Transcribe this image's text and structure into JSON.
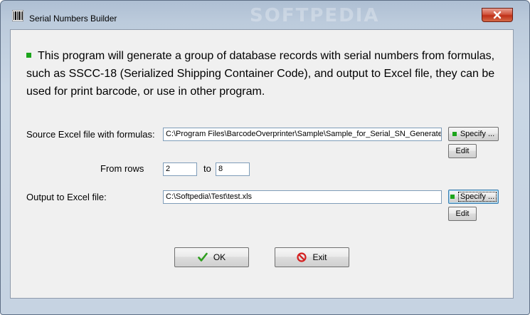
{
  "window": {
    "title": "Serial Numbers Builder",
    "watermark": "SOFTPEDIA",
    "icons": {
      "app": "barcode-icon",
      "close": "close-icon"
    }
  },
  "intro": {
    "text": "This program will generate a group of database records with serial numbers from formulas, such as SSCC-18 (Serialized Shipping Container Code), and output to Excel file, they can be used for print barcode, or use in other program."
  },
  "source": {
    "label": "Source Excel file with formulas:",
    "value": "C:\\Program Files\\BarcodeOverprinter\\Sample\\Sample_for_Serial_SN_Generate.xls",
    "specify_label": "Specify ...",
    "edit_label": "Edit"
  },
  "rows": {
    "label": "From rows",
    "from": "2",
    "to_label": "to",
    "to": "8"
  },
  "output": {
    "label": "Output to Excel file:",
    "value": "C:\\Softpedia\\Test\\test.xls",
    "specify_label": "Specify ...",
    "edit_label": "Edit"
  },
  "actions": {
    "ok_label": "OK",
    "exit_label": "Exit",
    "ok_icon": "checkmark-icon",
    "exit_icon": "no-entry-icon"
  },
  "colors": {
    "accent_green": "#1ca51c",
    "close_red": "#c7402a",
    "exit_red": "#d42020"
  }
}
